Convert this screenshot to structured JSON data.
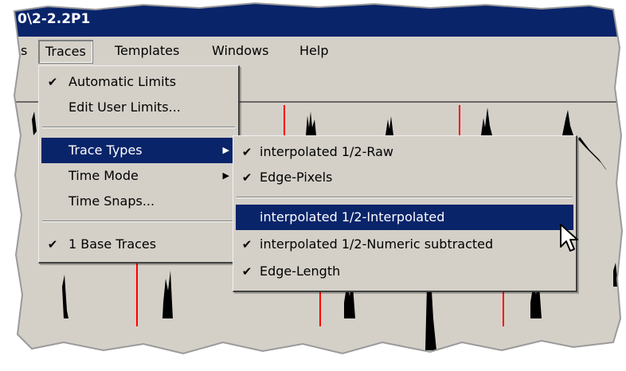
{
  "window": {
    "title_fragment": "0\\2-2.2P1"
  },
  "menubar": {
    "items": [
      "s",
      "Traces",
      "Templates",
      "Windows",
      "Help"
    ]
  },
  "traces_menu": {
    "items": [
      {
        "label": "Automatic Limits",
        "checked": true
      },
      {
        "label": "Edit User Limits...",
        "checked": false
      },
      {
        "label": "Trace Types",
        "checked": false,
        "submenu": true,
        "highlighted": true
      },
      {
        "label": "Time Mode",
        "checked": false,
        "submenu": true
      },
      {
        "label": "Time Snaps...",
        "checked": false
      },
      {
        "label": "1 Base Traces",
        "checked": true
      }
    ]
  },
  "trace_types_submenu": {
    "items": [
      {
        "label": "interpolated 1/2-Raw",
        "checked": true
      },
      {
        "label": "Edge-Pixels",
        "checked": true
      },
      {
        "label": "interpolated 1/2-Interpolated",
        "checked": false,
        "highlighted": true
      },
      {
        "label": "interpolated 1/2-Numeric subtracted",
        "checked": true
      },
      {
        "label": "Edge-Length",
        "checked": true
      }
    ]
  },
  "icons": {
    "check": "check-icon",
    "submenu_arrow": "submenu-arrow-icon",
    "cursor": "mouse-pointer-icon"
  },
  "colors": {
    "title_bar": "#0a246a",
    "highlight": "#0a246a",
    "menu_bg": "#d4d0c8",
    "trace_red": "#ff0000"
  }
}
